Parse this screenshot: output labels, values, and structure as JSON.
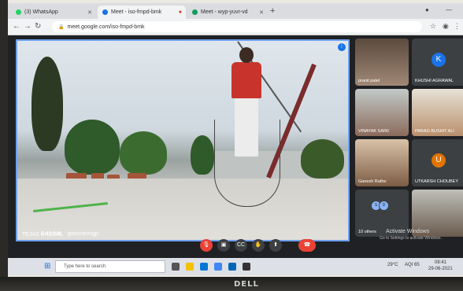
{
  "tabs": [
    {
      "label": "(3) WhatsApp",
      "color": "#25d366"
    },
    {
      "label": "Meet - iso-fmpd-bmk",
      "color": "#1a73e8"
    },
    {
      "label": "Meet - wyp-yuvr-vd",
      "color": "#0f9d58"
    }
  ],
  "address": {
    "url": "meet.google.com/iso-fmpd-bmk"
  },
  "main_video": {
    "name": "TEJAS KHODAL"
  },
  "participants": [
    {
      "label": "pranit patel",
      "type": "photo"
    },
    {
      "label": "KHUSHI AGRAWAL",
      "type": "avatar",
      "initial": "K",
      "color": "#1a73e8"
    },
    {
      "label": "VINAYAK SAINI",
      "type": "photo"
    },
    {
      "label": "PARAG BUSHIT ALI",
      "type": "photo"
    },
    {
      "label": "Ganesh Rathe",
      "type": "photo"
    },
    {
      "label": "UTKARSH CHOUBEY",
      "type": "avatar",
      "initial": "U",
      "color": "#e37400"
    },
    {
      "label": "10 others",
      "type": "others"
    },
    {
      "label": "",
      "type": "photo"
    }
  ],
  "callbar": {
    "time": "8:41 AM",
    "meeting_code": "gwocnevngp"
  },
  "watermark": {
    "title": "Activate Windows",
    "subtitle": "Go to Settings to activate Windows."
  },
  "taskbar": {
    "search_placeholder": "Type here to search",
    "weather": "29°C",
    "aqi": "AQI 65",
    "clock_time": "08:41",
    "clock_date": "29-06-2021"
  },
  "brand": "DELL"
}
